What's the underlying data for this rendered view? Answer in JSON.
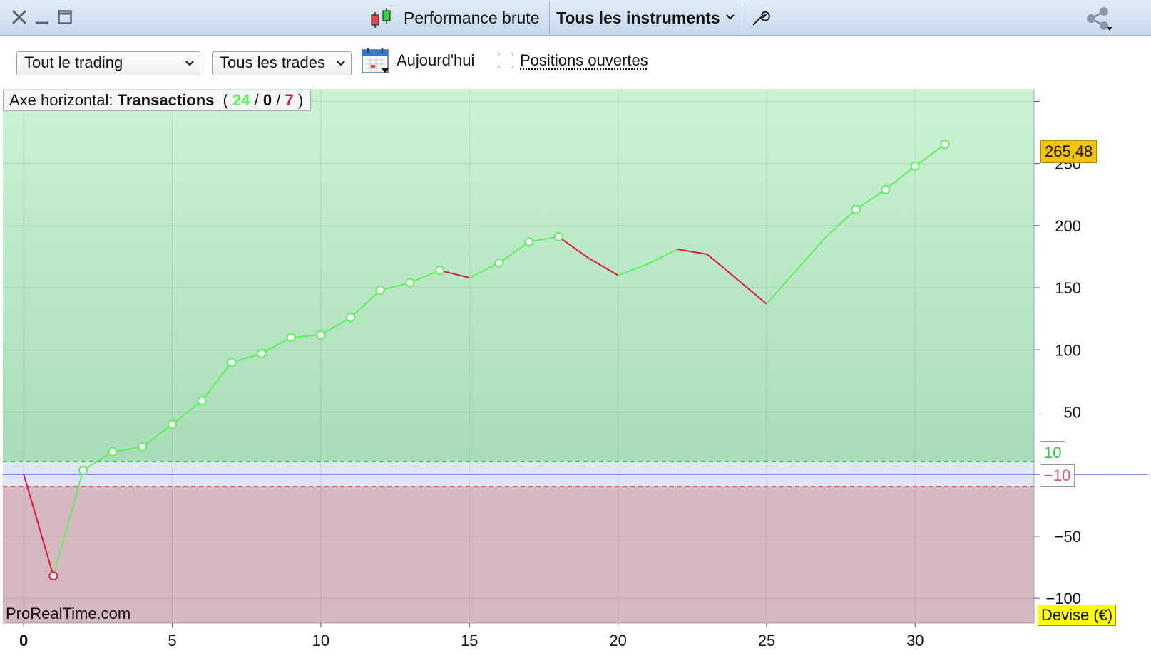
{
  "window": {
    "title": "Performance brute",
    "instrument_selector": "Tous les instruments"
  },
  "toolbar": {
    "scope_select": "Tout le trading",
    "trades_select": "Tous les trades",
    "date_label": "Aujourd'hui",
    "open_positions_label": "Positions ouvertes",
    "open_positions_checked": false
  },
  "axis_info": {
    "prefix": "Axe horizontal:",
    "mode": "Transactions",
    "open_paren": "(",
    "wins": "24",
    "sep1": "/",
    "neutral": "0",
    "sep2": "/",
    "losses": "7",
    "close_paren": ")"
  },
  "labels": {
    "last_value": "265,48",
    "upper_threshold": "10",
    "lower_threshold": "−10",
    "watermark": "ProRealTime.com",
    "currency": "Devise (€)"
  },
  "colors": {
    "gain_line": "#5cf25c",
    "loss_line": "#e8143c",
    "gain_area": "#c2efcc",
    "loss_area": "#d5b8c2",
    "zero_line": "#2a3bb5",
    "last_value_badge": "#f5c400",
    "currency_badge": "#ffff00"
  },
  "chart_data": {
    "type": "line",
    "x": [
      0,
      1,
      2,
      3,
      4,
      5,
      6,
      7,
      8,
      9,
      10,
      11,
      12,
      13,
      14,
      15,
      16,
      17,
      18,
      19,
      20,
      21,
      22,
      23,
      24,
      25,
      26,
      27,
      28,
      29,
      30,
      31
    ],
    "y": [
      0,
      -82,
      3,
      18,
      22,
      40,
      59,
      90,
      97,
      110,
      112,
      126,
      148,
      154,
      164,
      158,
      170,
      187,
      191,
      174,
      160,
      169,
      181,
      177,
      157,
      137,
      164,
      191,
      213,
      229,
      248,
      265.48
    ],
    "markers": [
      1,
      2,
      3,
      4,
      5,
      6,
      7,
      8,
      9,
      10,
      11,
      12,
      13,
      14,
      16,
      17,
      18,
      28,
      29,
      30,
      31
    ],
    "thresholds": [
      10,
      -10
    ],
    "xlim": [
      -0.7,
      34
    ],
    "ylim": [
      -120,
      310
    ],
    "x_ticks": [
      0,
      5,
      10,
      15,
      20,
      25,
      30
    ],
    "x_tick_labels": [
      "0",
      "5",
      "10",
      "15",
      "20",
      "25",
      "30"
    ],
    "y_ticks": [
      250,
      200,
      150,
      100,
      50,
      -50,
      -100
    ],
    "y_tick_labels": [
      "250",
      "200",
      "150",
      "100",
      "50",
      "−50",
      "−100"
    ],
    "grid": true
  }
}
